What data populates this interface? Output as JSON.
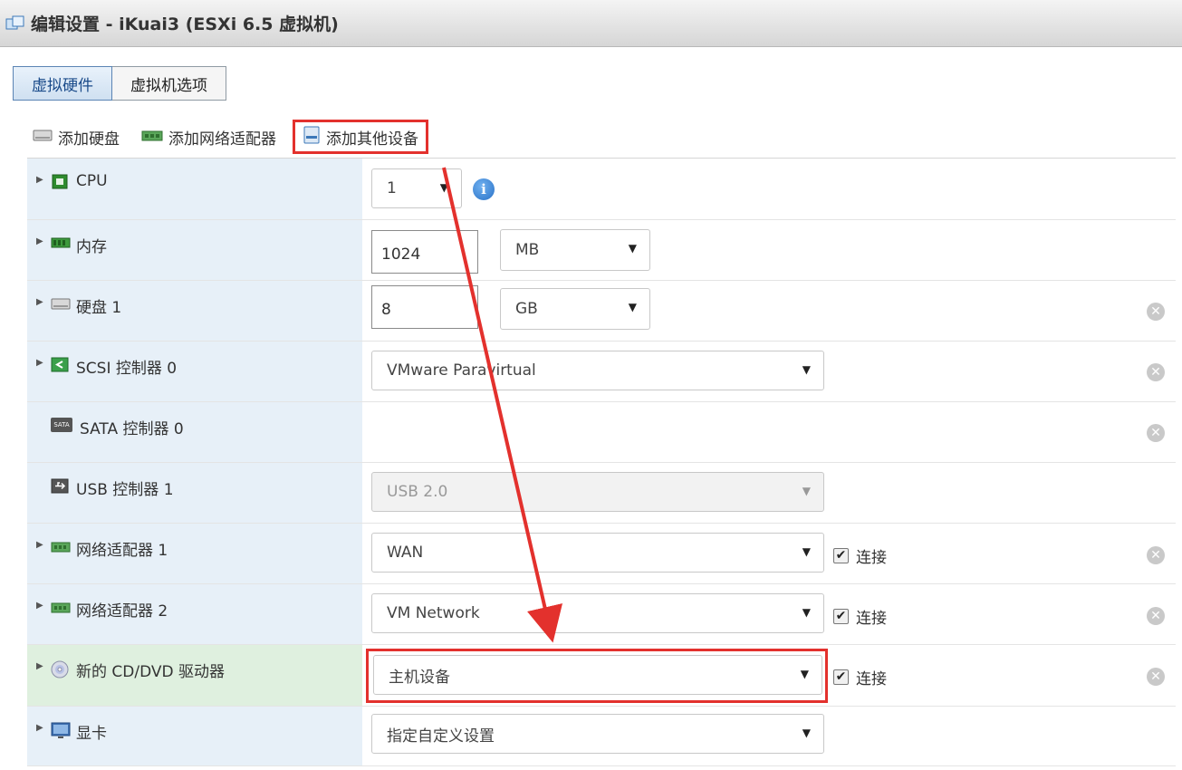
{
  "window": {
    "title": "编辑设置 - iKuai3 (ESXi 6.5 虚拟机)"
  },
  "tabs": [
    {
      "label": "虚拟硬件",
      "active": true
    },
    {
      "label": "虚拟机选项",
      "active": false
    }
  ],
  "toolbar": {
    "add_disk": "添加硬盘",
    "add_nic": "添加网络适配器",
    "add_other": "添加其他设备"
  },
  "hardware": {
    "cpu": {
      "label": "CPU",
      "value": "1",
      "info_glyph": "i"
    },
    "mem": {
      "label": "内存",
      "value": "1024",
      "unit": "MB"
    },
    "disk": {
      "label": "硬盘 1",
      "value": "8",
      "unit": "GB"
    },
    "scsi": {
      "label": "SCSI 控制器 0",
      "value": "VMware Paravirtual"
    },
    "sata": {
      "label": "SATA 控制器 0",
      "icon_text": "SATA"
    },
    "usb": {
      "label": "USB 控制器 1",
      "value": "USB 2.0"
    },
    "nic1": {
      "label": "网络适配器 1",
      "value": "WAN",
      "connect_label": "连接",
      "connected": true
    },
    "nic2": {
      "label": "网络适配器 2",
      "value": "VM Network",
      "connect_label": "连接",
      "connected": true
    },
    "cddvd": {
      "label": "新的 CD/DVD 驱动器",
      "value": "主机设备",
      "connect_label": "连接",
      "connected": true
    },
    "video": {
      "label": "显卡",
      "value": "指定自定义设置"
    }
  },
  "glyphs": {
    "expand": "▶",
    "dropdown": "▼",
    "check": "✔",
    "remove": "✕"
  },
  "colors": {
    "highlight": "#e3312d",
    "label_bg": "#e7f0f8",
    "selected_bg": "#dff0df",
    "info_blue": "#2a72c7"
  }
}
